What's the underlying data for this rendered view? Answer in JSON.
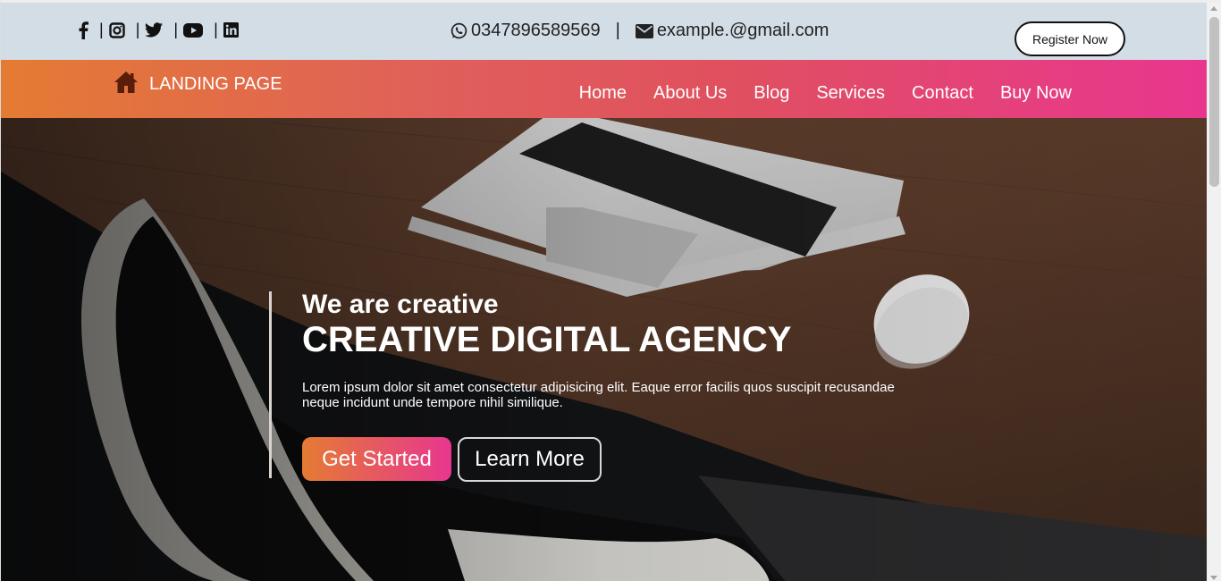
{
  "topbar": {
    "social": [
      {
        "icon": "facebook-icon"
      },
      {
        "icon": "instagram-icon"
      },
      {
        "icon": "twitter-icon"
      },
      {
        "icon": "youtube-icon"
      },
      {
        "icon": "linkedin-icon"
      }
    ],
    "separator": "|",
    "phone": "0347896589569",
    "email": "example.@gmail.com",
    "contact_separator": "|",
    "register_label": "Register Now"
  },
  "navbar": {
    "brand": "LANDING PAGE",
    "brand_icon": "home-icon",
    "items": [
      "Home",
      "About Us",
      "Blog",
      "Services",
      "Contact",
      "Buy Now"
    ],
    "gradient_start": "#e47b33",
    "gradient_end": "#e8368f"
  },
  "hero": {
    "tagline": "We are creative",
    "headline": "CREATIVE DIGITAL AGENCY",
    "description": "Lorem ipsum dolor sit amet consectetur adipisicing elit. Eaque error facilis quos suscipit recusandae neque incidunt unde tempore nihil similique.",
    "primary_cta": "Get Started",
    "secondary_cta": "Learn More"
  }
}
